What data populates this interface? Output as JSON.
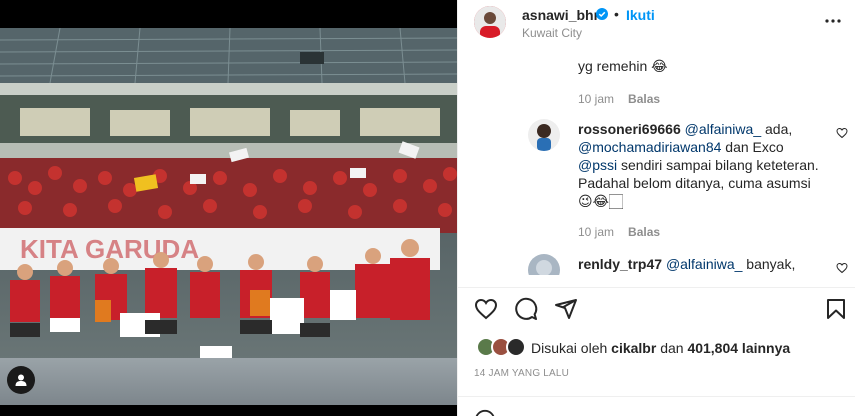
{
  "post": {
    "username": "asnawi_bhr",
    "follow_label": "Ikuti",
    "separator": "•",
    "location": "Kuwait City",
    "likes_prefix": "Disukai oleh",
    "likes_user": "cikalbr",
    "likes_joiner": "dan",
    "likes_count": "401,804 lainnya",
    "time_ago": "14 JAM YANG LALU"
  },
  "comments": [
    {
      "text": "yg remehin 😂",
      "time": "10 jam",
      "reply": "Balas"
    },
    {
      "user": "rossoneri69666",
      "mention1": "@alfainiwa_",
      "text1": " ada,",
      "mention2": "@mochamadiriawan84",
      "text2": " dan Exco ",
      "mention3": "@pssi",
      "text3": "sendiri sampai bilang keteteran. Padahal belom ditanya, cuma asumsi😉😂🏻",
      "time": "10 jam",
      "reply": "Balas"
    },
    {
      "user": "renldy_trp47",
      "mention1": "@alfainiwa_",
      "text1": " banyak, bocil"
    }
  ],
  "icons": {
    "verified": "verified-badge-icon",
    "more": "more-options-icon",
    "like": "heart-icon",
    "comment": "comment-icon",
    "share": "share-icon",
    "save": "bookmark-icon",
    "tag": "user-tag-icon"
  },
  "colors": {
    "accent": "#0095f6",
    "mention": "#00376b",
    "muted": "#8e8e8e",
    "text": "#262626"
  }
}
